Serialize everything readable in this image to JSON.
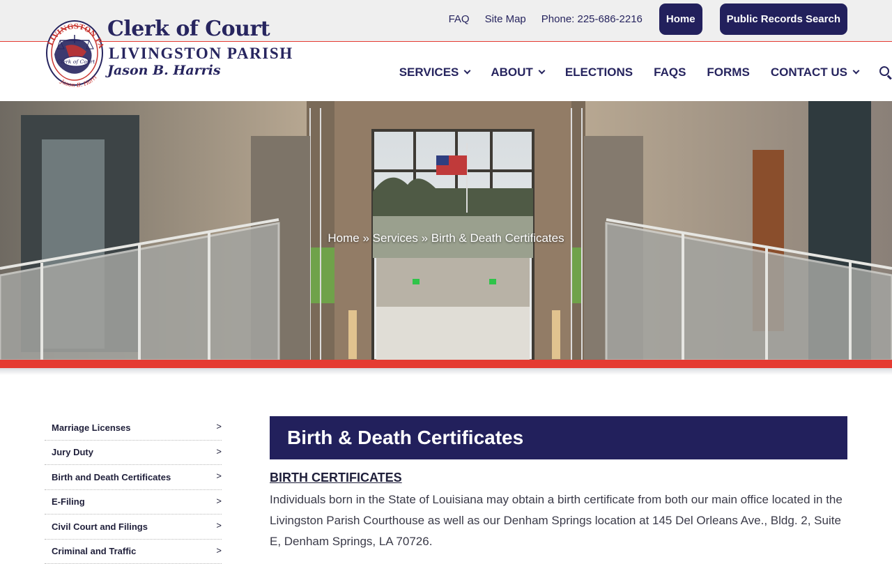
{
  "colors": {
    "brand_navy": "#22205c",
    "accent_red": "#e53b32",
    "topbar_bg": "#efefef"
  },
  "header": {
    "util_links": {
      "faq": "FAQ",
      "sitemap": "Site Map",
      "phone": "Phone: 225-686-2216"
    },
    "buttons": {
      "home": "Home",
      "records": "Public Records Search"
    },
    "logo": {
      "title": "Clerk of Court",
      "subtitle": "LIVINGSTON PARISH",
      "name": "Jason B. Harris",
      "seal_top": "LIVINGSTON PARISH",
      "seal_center": "Clerk of Court",
      "seal_bottom": "Jason B. Harris"
    }
  },
  "nav": {
    "services": "SERVICES",
    "about": "ABOUT",
    "elections": "ELECTIONS",
    "faqs": "FAQS",
    "forms": "FORMS",
    "contact": "CONTACT US",
    "search_icon": "search-icon"
  },
  "breadcrumb": {
    "home": "Home",
    "sep1": " » ",
    "services": "Services",
    "sep2": " » ",
    "current": "Birth & Death Certificates"
  },
  "sidebar": {
    "items": [
      {
        "label": "Marriage Licenses",
        "arrow": ">"
      },
      {
        "label": "Jury Duty",
        "arrow": ">"
      },
      {
        "label": "Birth and Death Certificates",
        "arrow": ">"
      },
      {
        "label": "E-Filing",
        "arrow": ">"
      },
      {
        "label": "Civil Court and Filings",
        "arrow": ">"
      },
      {
        "label": "Criminal and Traffic",
        "arrow": ">"
      }
    ]
  },
  "content": {
    "heading": "Birth & Death Certificates",
    "section_title": "BIRTH CERTIFICATES",
    "paragraph": "Individuals born in the State of Louisiana may obtain a birth certificate from both our main office located in the Livingston Parish Courthouse as well as our Denham Springs location at 145 Del Orleans Ave., Bldg. 2, Suite E, Denham Springs, LA 70726."
  }
}
